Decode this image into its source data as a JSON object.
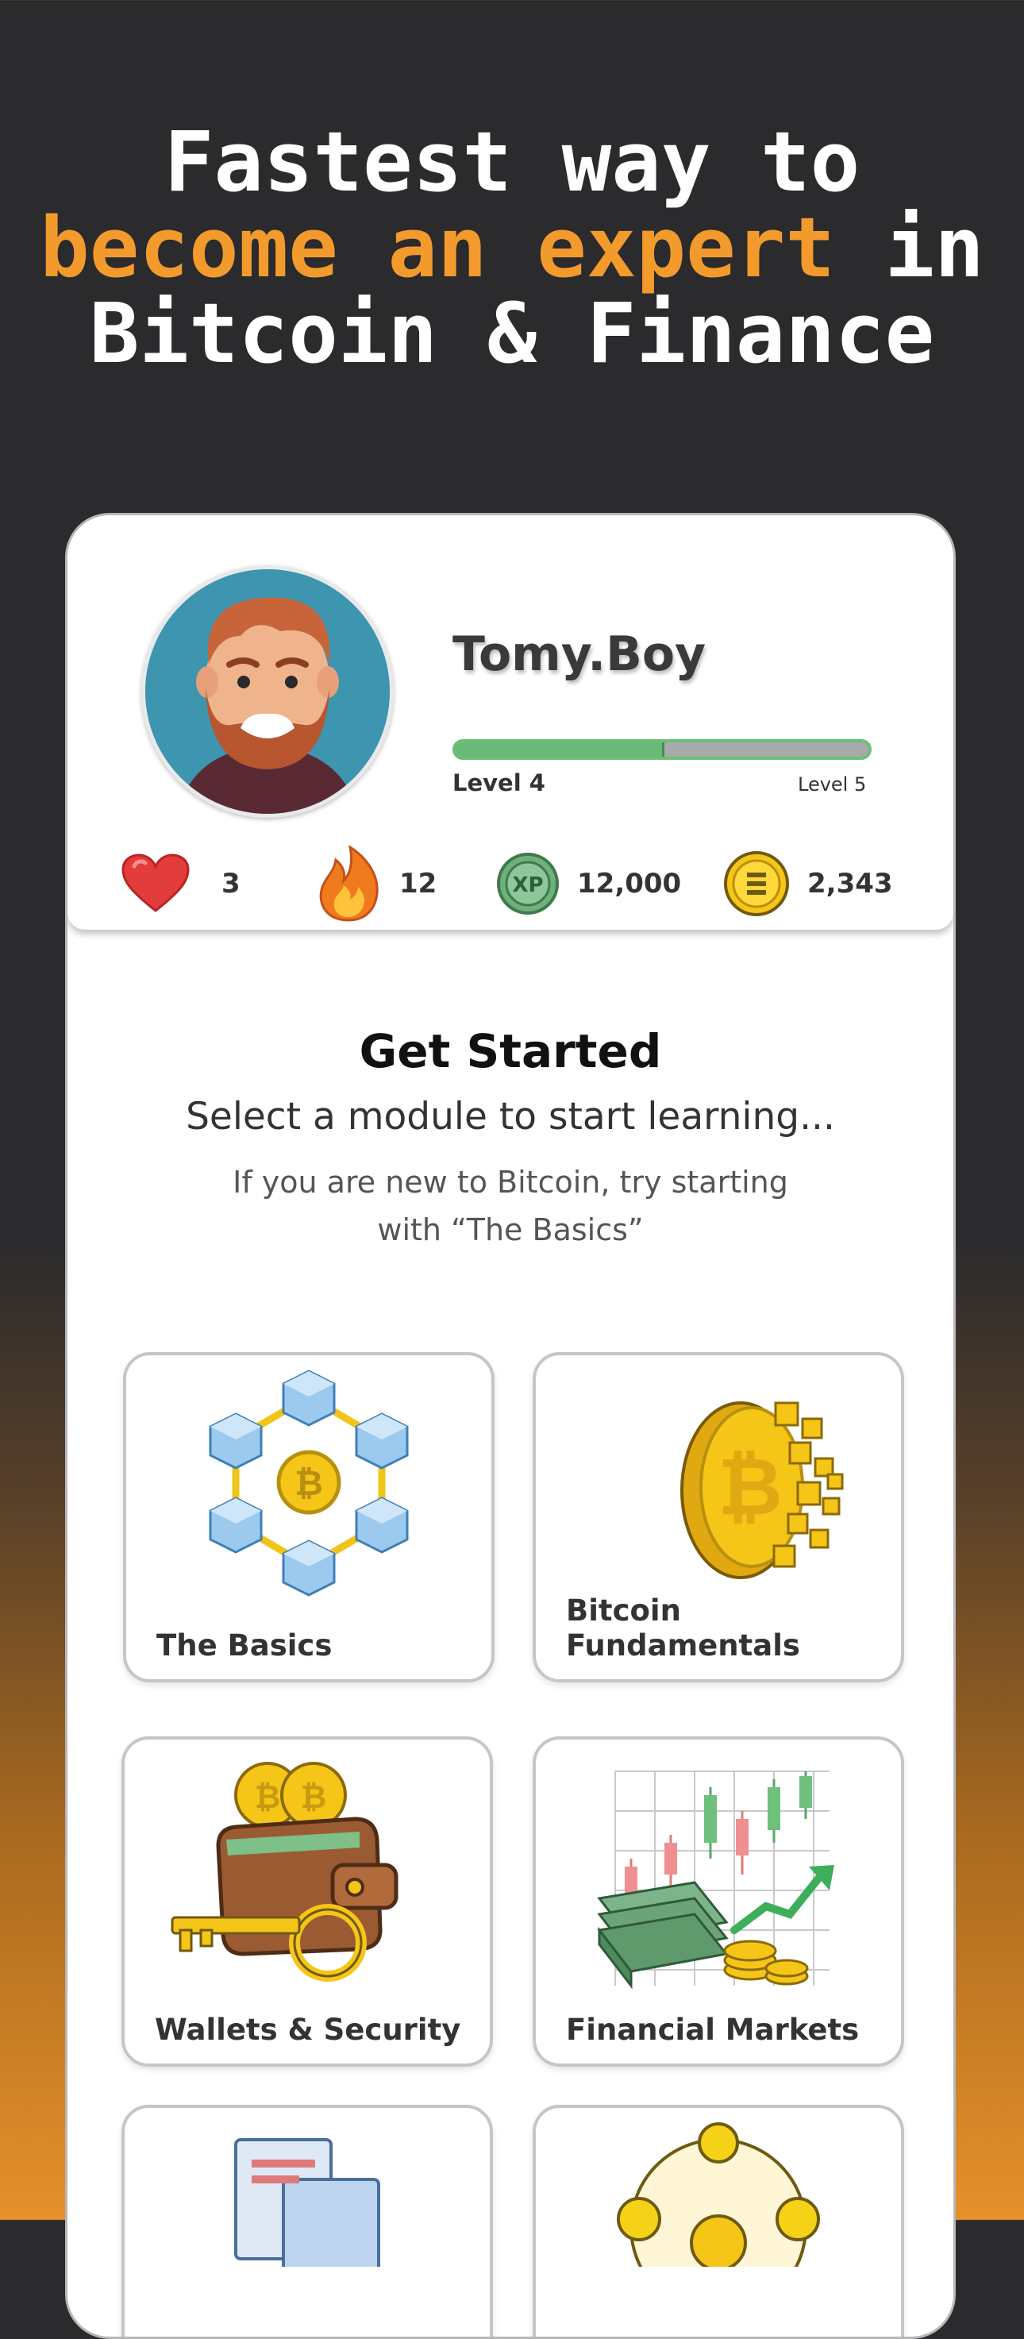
{
  "headline": {
    "line1": "Fastest way to",
    "highlight": "become an expert",
    "line2_suffix": " in",
    "line3": "Bitcoin & Finance"
  },
  "profile": {
    "username": "Tomy.Boy",
    "level_current": "Level 4",
    "level_next": "Level 5",
    "level_progress": 0.5,
    "stats": {
      "hearts": "3",
      "streak": "12",
      "xp": "12,000",
      "coins": "2,343"
    }
  },
  "intro": {
    "title": "Get Started",
    "subtitle": "Select a module to start learning...",
    "hint": "If you are new to Bitcoin, try starting with “The Basics”"
  },
  "modules": [
    {
      "label": "The Basics",
      "icon": "blockchain-hexagon-icon"
    },
    {
      "label": "Bitcoin Fundamentals",
      "icon": "bitcoin-coin-icon"
    },
    {
      "label": "Wallets & Security",
      "icon": "wallet-key-icon"
    },
    {
      "label": "Financial Markets",
      "icon": "candlestick-chart-icon"
    },
    {
      "label": "",
      "icon": "documents-icon"
    },
    {
      "label": "",
      "icon": "network-icon"
    }
  ],
  "colors": {
    "accent": "#f39a2c",
    "dark_bg": "#2b2a2d",
    "progress_green": "#69b977"
  }
}
